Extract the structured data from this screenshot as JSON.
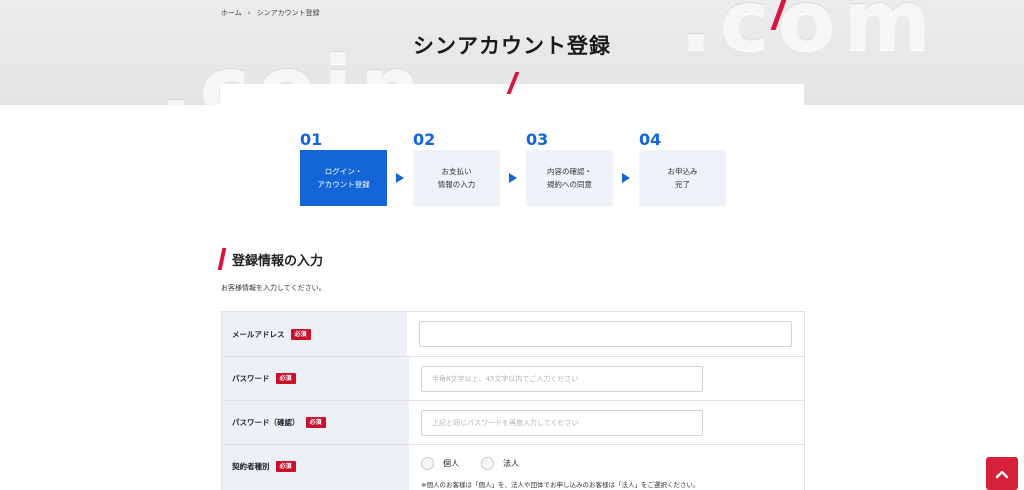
{
  "breadcrumb": {
    "home": "ホーム",
    "separator": "›",
    "current": "シンアカウント登録"
  },
  "hero": {
    "watermark_left": ".coin",
    "watermark_right": ".com",
    "title": "シンアカウント登録"
  },
  "steps": [
    {
      "num": "01",
      "line1": "ログイン・",
      "line2": "アカウント登録",
      "active": true
    },
    {
      "num": "02",
      "line1": "お支払い",
      "line2": "情報の入力",
      "active": false
    },
    {
      "num": "03",
      "line1": "内容の確認・",
      "line2": "規約への同意",
      "active": false
    },
    {
      "num": "04",
      "line1": "お申込み",
      "line2": "完了",
      "active": false
    }
  ],
  "section": {
    "title": "登録情報の入力",
    "description": "お客様情報を入力してください。"
  },
  "form": {
    "required_badge": "必須",
    "email": {
      "label": "メールアドレス",
      "value": "",
      "placeholder": ""
    },
    "password": {
      "label": "パスワード",
      "value": "",
      "placeholder": "半角8文字以上、45文字以内でご入力ください"
    },
    "password_confirm": {
      "label": "パスワード（確認）",
      "value": "",
      "placeholder": "上記と同じパスワードを再度入力してください"
    },
    "contract_type": {
      "label": "契約者種別",
      "options": [
        "個人",
        "法人"
      ],
      "note": "※個人のお客様は「個人」を、法人や団体でお申し込みのお客様は「法人」をご選択ください。"
    }
  },
  "colors": {
    "accent_blue": "#1466d8",
    "accent_red": "#d5173f",
    "required_red": "#c8102e"
  },
  "icons": {
    "scroll_top": "chevron-up-icon",
    "step_arrow": "triangle-right-icon"
  }
}
